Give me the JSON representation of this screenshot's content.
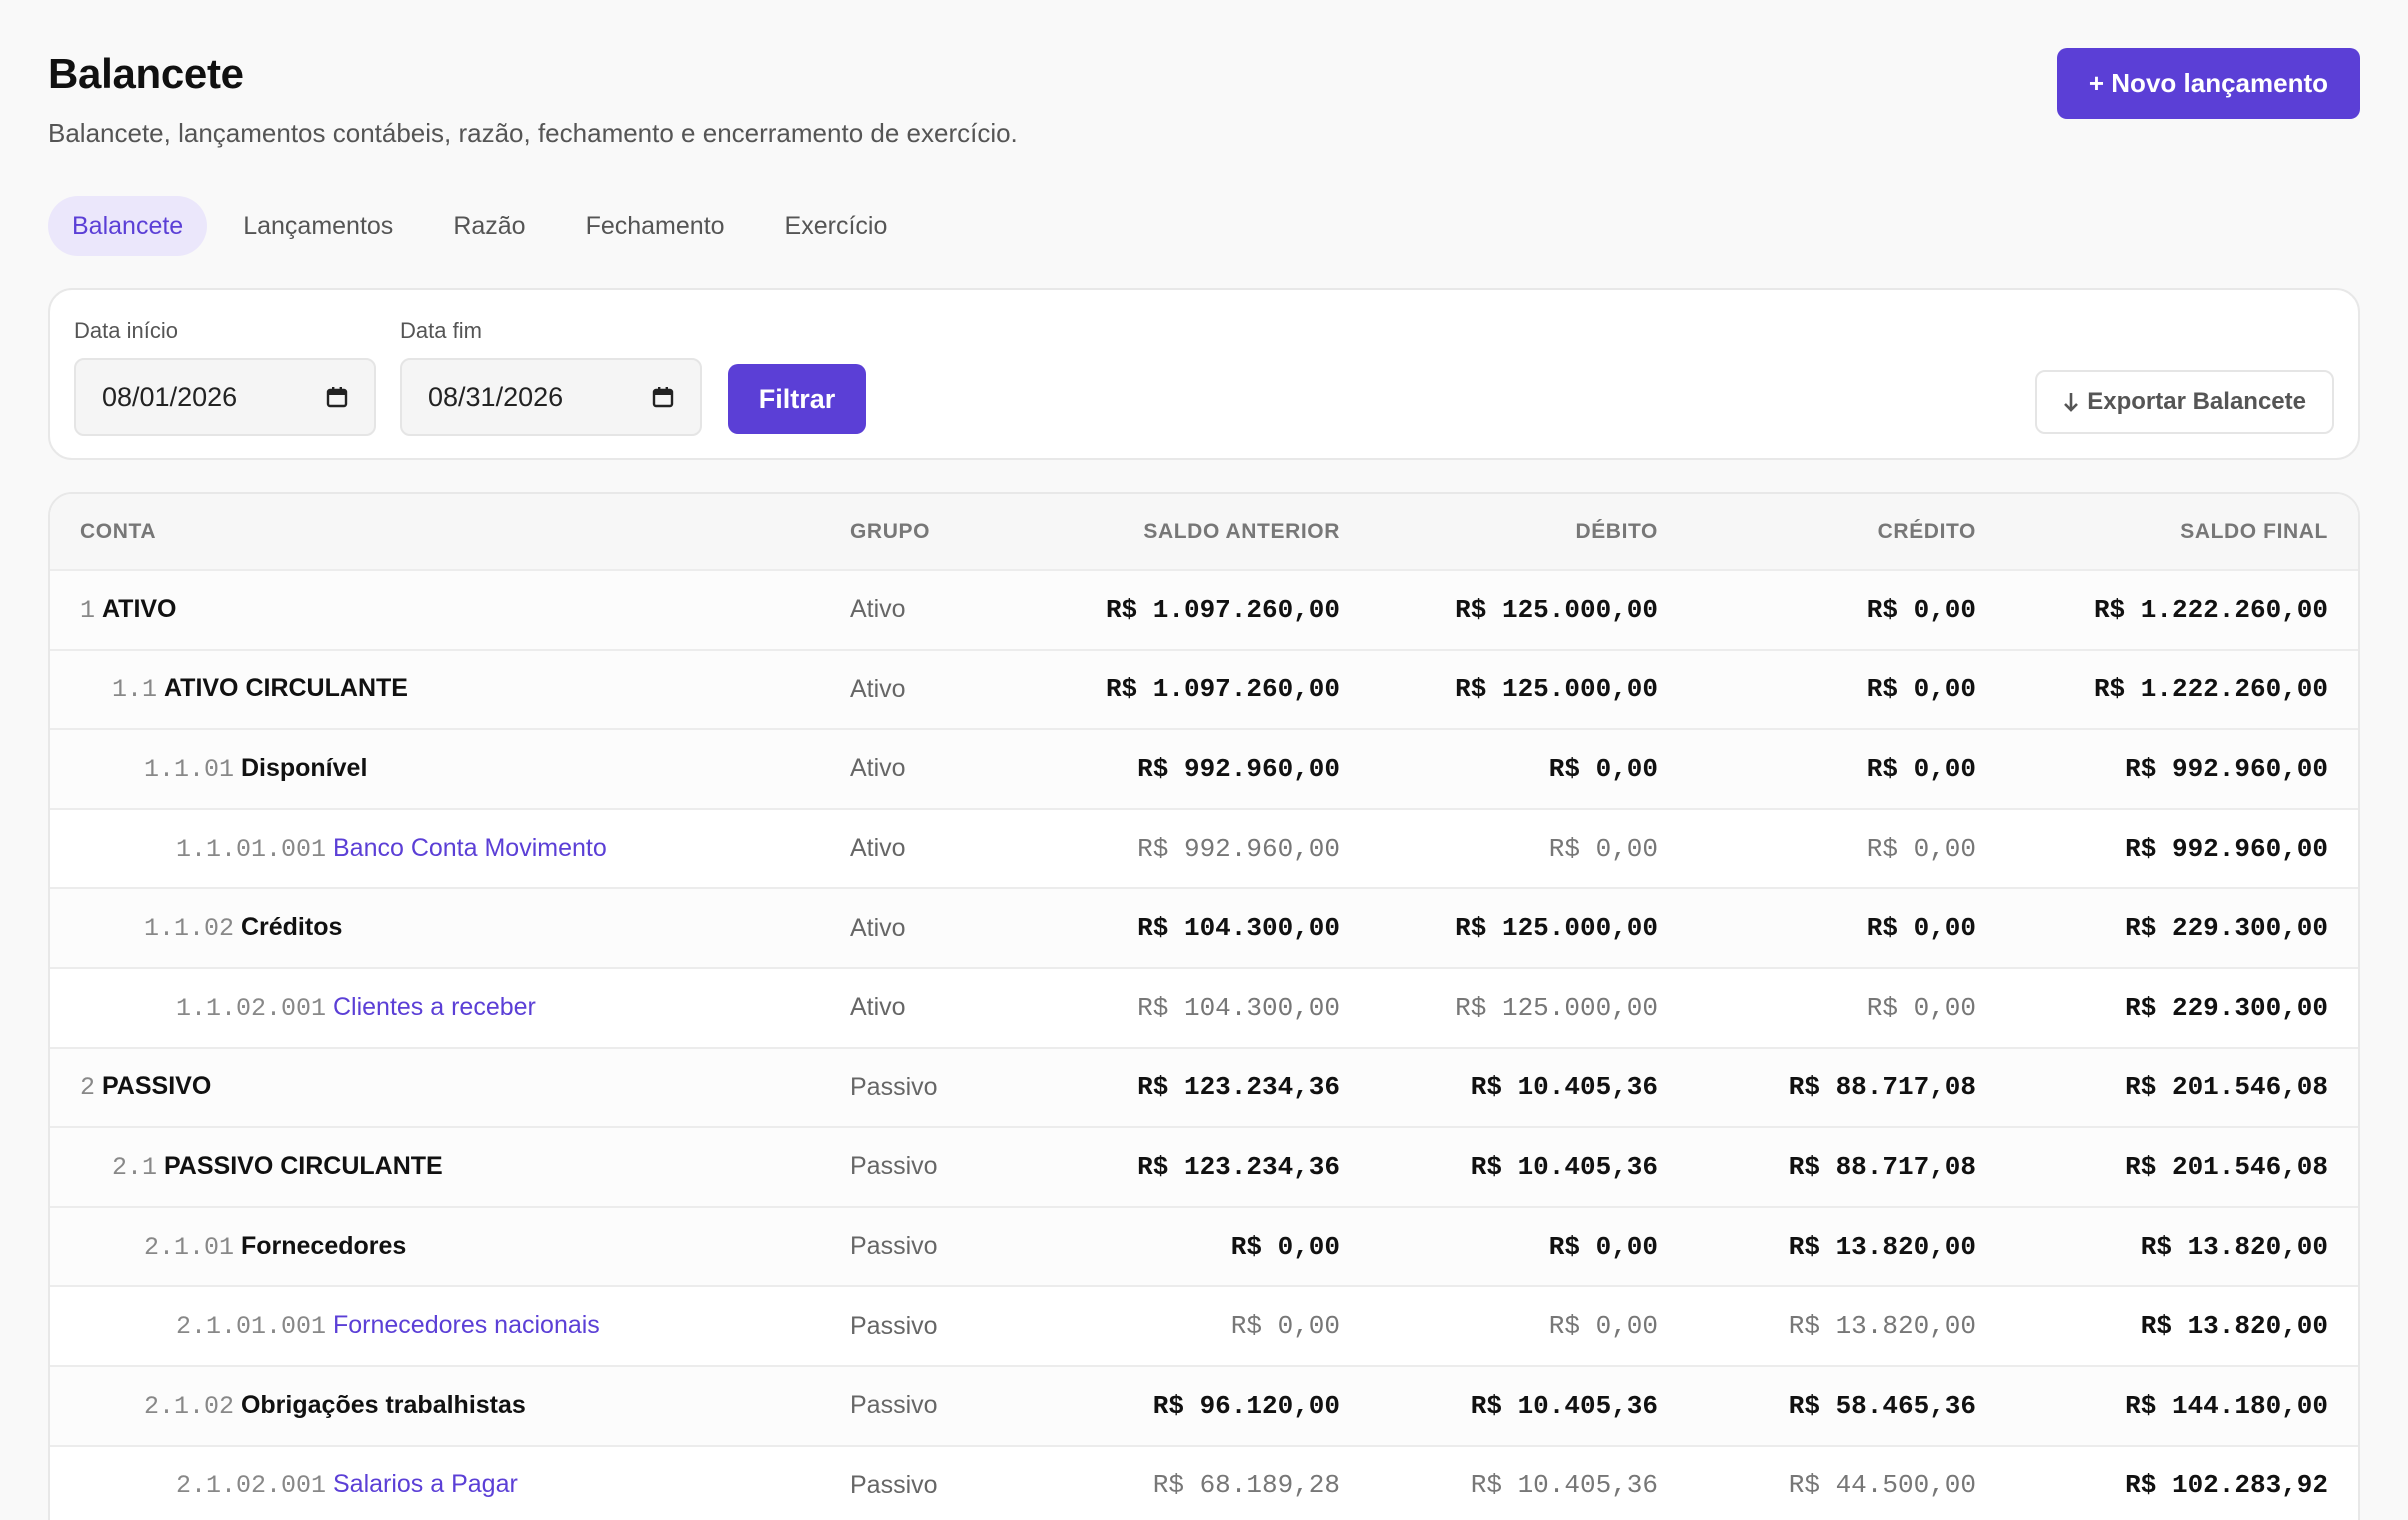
{
  "header": {
    "title": "Balancete",
    "subtitle": "Balancete, lançamentos contábeis, razão, fechamento e encerramento de exercício.",
    "new_entry_label": "+ Novo lançamento"
  },
  "tabs": [
    {
      "label": "Balancete",
      "active": true
    },
    {
      "label": "Lançamentos"
    },
    {
      "label": "Razão"
    },
    {
      "label": "Fechamento"
    },
    {
      "label": "Exercício"
    }
  ],
  "filters": {
    "start_label": "Data início",
    "start_value": "08/01/2026",
    "end_label": "Data fim",
    "end_value": "08/31/2026",
    "filter_label": "Filtrar",
    "export_label": "Exportar Balancete",
    "export_icon": "arrow-down-icon",
    "date_icon": "calendar-icon"
  },
  "table": {
    "columns": [
      "CONTA",
      "GRUPO",
      "SALDO ANTERIOR",
      "DÉBITO",
      "CRÉDITO",
      "SALDO FINAL"
    ],
    "rows": [
      {
        "level": 0,
        "code": "1",
        "name": "ATIVO",
        "group": "Ativo",
        "prev": "R$ 1.097.260,00",
        "debit": "R$ 125.000,00",
        "credit": "R$ 0,00",
        "final": "R$ 1.222.260,00"
      },
      {
        "level": 1,
        "code": "1.1",
        "name": "ATIVO CIRCULANTE",
        "group": "Ativo",
        "prev": "R$ 1.097.260,00",
        "debit": "R$ 125.000,00",
        "credit": "R$ 0,00",
        "final": "R$ 1.222.260,00"
      },
      {
        "level": 2,
        "code": "1.1.01",
        "name": "Disponível",
        "group": "Ativo",
        "prev": "R$ 992.960,00",
        "debit": "R$ 0,00",
        "credit": "R$ 0,00",
        "final": "R$ 992.960,00"
      },
      {
        "level": 3,
        "code": "1.1.01.001",
        "name": "Banco Conta Movimento",
        "group": "Ativo",
        "prev": "R$ 992.960,00",
        "debit": "R$ 0,00",
        "credit": "R$ 0,00",
        "final": "R$ 992.960,00"
      },
      {
        "level": 2,
        "code": "1.1.02",
        "name": "Créditos",
        "group": "Ativo",
        "prev": "R$ 104.300,00",
        "debit": "R$ 125.000,00",
        "credit": "R$ 0,00",
        "final": "R$ 229.300,00"
      },
      {
        "level": 3,
        "code": "1.1.02.001",
        "name": "Clientes a receber",
        "group": "Ativo",
        "prev": "R$ 104.300,00",
        "debit": "R$ 125.000,00",
        "credit": "R$ 0,00",
        "final": "R$ 229.300,00"
      },
      {
        "level": 0,
        "code": "2",
        "name": "PASSIVO",
        "group": "Passivo",
        "prev": "R$ 123.234,36",
        "debit": "R$ 10.405,36",
        "credit": "R$ 88.717,08",
        "final": "R$ 201.546,08"
      },
      {
        "level": 1,
        "code": "2.1",
        "name": "PASSIVO CIRCULANTE",
        "group": "Passivo",
        "prev": "R$ 123.234,36",
        "debit": "R$ 10.405,36",
        "credit": "R$ 88.717,08",
        "final": "R$ 201.546,08"
      },
      {
        "level": 2,
        "code": "2.1.01",
        "name": "Fornecedores",
        "group": "Passivo",
        "prev": "R$ 0,00",
        "debit": "R$ 0,00",
        "credit": "R$ 13.820,00",
        "final": "R$ 13.820,00"
      },
      {
        "level": 3,
        "code": "2.1.01.001",
        "name": "Fornecedores nacionais",
        "group": "Passivo",
        "prev": "R$ 0,00",
        "debit": "R$ 0,00",
        "credit": "R$ 13.820,00",
        "final": "R$ 13.820,00"
      },
      {
        "level": 2,
        "code": "2.1.02",
        "name": "Obrigações trabalhistas",
        "group": "Passivo",
        "prev": "R$ 96.120,00",
        "debit": "R$ 10.405,36",
        "credit": "R$ 58.465,36",
        "final": "R$ 144.180,00"
      },
      {
        "level": 3,
        "code": "2.1.02.001",
        "name": "Salarios a Pagar",
        "group": "Passivo",
        "prev": "R$ 68.189,28",
        "debit": "R$ 10.405,36",
        "credit": "R$ 44.500,00",
        "final": "R$ 102.283,92"
      }
    ]
  },
  "colors": {
    "accent": "#5b3fd6",
    "accent_soft": "#ebe7fb"
  }
}
